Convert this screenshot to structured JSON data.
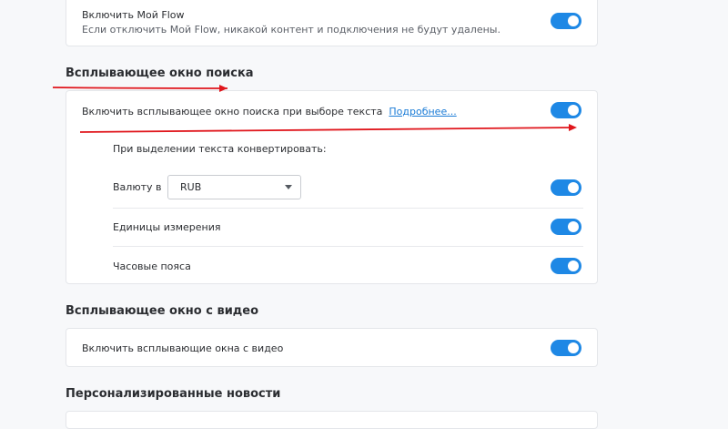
{
  "myflow": {
    "title": "Включить Мой Flow",
    "description": "Если отключить Мой Flow, никакой контент и подключения не будут удалены.",
    "enabled": true
  },
  "search_popup": {
    "section_title": "Всплывающее окно поиска",
    "enable_label": "Включить всплывающее окно поиска при выборе текста",
    "more_link": "Подробнее...",
    "enabled": true,
    "convert_label": "При выделении текста конвертировать:",
    "currency_label": "Валюту в",
    "currency_value": "RUB",
    "currency_enabled": true,
    "units_label": "Единицы измерения",
    "units_enabled": true,
    "timezones_label": "Часовые пояса",
    "timezones_enabled": true
  },
  "video_popup": {
    "section_title": "Всплывающее окно с видео",
    "enable_label": "Включить всплывающие окна с видео",
    "enabled": true
  },
  "news": {
    "section_title": "Персонализированные новости"
  },
  "colors": {
    "toggle_on": "#1e88e5",
    "link": "#1a7bd6",
    "annotation_arrow": "#e0161c"
  }
}
